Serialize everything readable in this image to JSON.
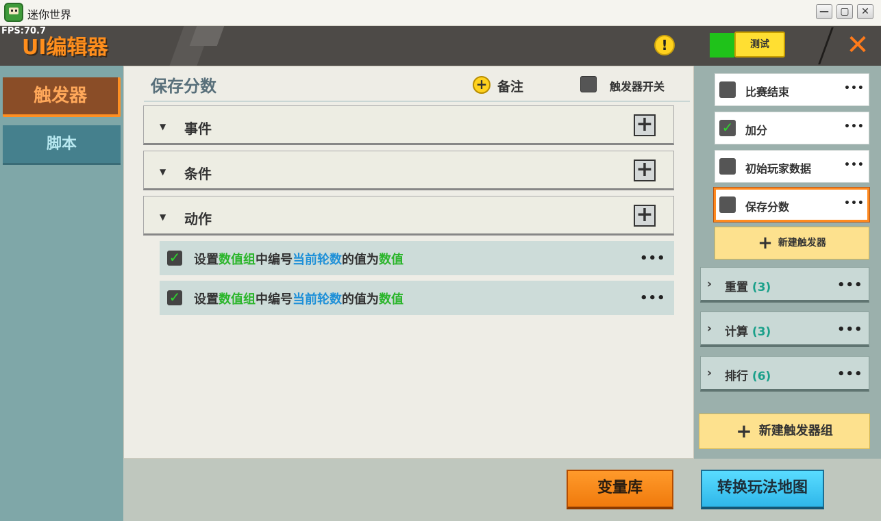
{
  "window": {
    "title": "迷你世界",
    "minimize": "—",
    "maximize": "▢",
    "close": "✕"
  },
  "header": {
    "fps": "FPS:70.7",
    "title": "UI编辑器",
    "warning_icon": "!",
    "test_label": "测试",
    "close_icon": "✕",
    "test_indicator_color": "#1fc21a",
    "accent_color": "#ff8e1c"
  },
  "nav": {
    "tabs": [
      {
        "label": "触发器",
        "active": true
      },
      {
        "label": "脚本",
        "active": false
      }
    ]
  },
  "main": {
    "title": "保存分数",
    "note_icon": "+",
    "note_label": "备注",
    "switch_label": "触发器开关",
    "sections": [
      {
        "label": "事件",
        "tri": "▼",
        "add": "+"
      },
      {
        "label": "条件",
        "tri": "▼",
        "add": "+"
      },
      {
        "label": "动作",
        "tri": "▼",
        "add": "+"
      }
    ],
    "actions": [
      {
        "checked": "✓",
        "p1": "设置",
        "p2": "数值组",
        "p3": "中编号",
        "p4": "当前轮数",
        "p5": "的值为",
        "p6": "数值",
        "more": "•••"
      },
      {
        "checked": "✓",
        "p1": "设置",
        "p2": "数值组",
        "p3": "中编号",
        "p4": "当前轮数",
        "p5": "的值为",
        "p6": "数值",
        "more": "•••"
      }
    ]
  },
  "right": {
    "triggers": [
      {
        "label": "比赛结束",
        "checked": "",
        "more": "•••"
      },
      {
        "label": "加分",
        "checked": "✓",
        "more": "•••"
      },
      {
        "label": "初始玩家数据",
        "checked": "",
        "more": "•••"
      },
      {
        "label": "保存分数",
        "checked": "",
        "more": "•••",
        "selected": true
      }
    ],
    "new_trigger": "新建触发器",
    "new_trigger_plus": "+",
    "groups": [
      {
        "chevron": "›",
        "label": "重置",
        "count": "(3)",
        "more": "•••"
      },
      {
        "chevron": "›",
        "label": "计算",
        "count": "(3)",
        "more": "•••"
      },
      {
        "chevron": "›",
        "label": "排行",
        "count": "(6)",
        "more": "•••"
      }
    ],
    "new_group": "新建触发器组",
    "new_group_plus": "+"
  },
  "bottom": {
    "variable_library": "变量库",
    "convert_map": "转换玩法地图"
  }
}
